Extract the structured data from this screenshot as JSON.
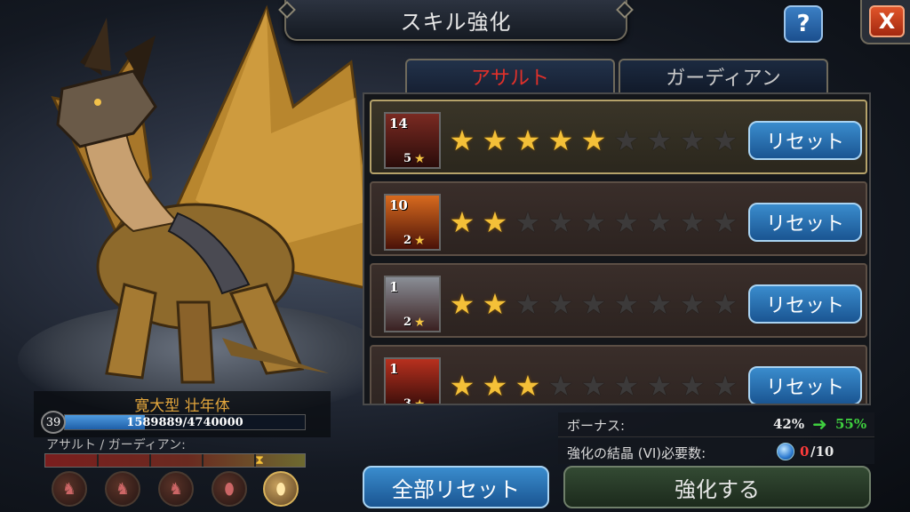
{
  "header": {
    "title": "スキル強化"
  },
  "buttons": {
    "help_label": "?",
    "close_label": "X"
  },
  "tabs": [
    {
      "label": "アサルト",
      "active": true
    },
    {
      "label": "ガーディアン",
      "active": false
    }
  ],
  "skills": [
    {
      "level": "14",
      "rank": "5",
      "stars_filled": 5,
      "stars_total": 9,
      "icon": "knights-icon",
      "reset_label": "リセット",
      "selected": true
    },
    {
      "level": "10",
      "rank": "2",
      "stars_filled": 2,
      "stars_total": 9,
      "icon": "fire-icon",
      "reset_label": "リセット",
      "selected": false
    },
    {
      "level": "1",
      "rank": "2",
      "stars_filled": 2,
      "stars_total": 9,
      "icon": "knight-icon",
      "reset_label": "リセット",
      "selected": false
    },
    {
      "level": "1",
      "rank": "3",
      "stars_filled": 3,
      "stars_total": 9,
      "icon": "warrior-icon",
      "reset_label": "リセット",
      "selected": false
    }
  ],
  "dragon": {
    "name": "寛大型 壮年体",
    "level": "39",
    "xp_text": "1589889/4740000",
    "xp_fraction": 0.335,
    "balance_label": "アサルト / ガーディアン:",
    "balance_fraction": 0.82
  },
  "dragon_slots": [
    {
      "icon": "dragon-head-icon",
      "active": false
    },
    {
      "icon": "dragon-head-icon",
      "active": false
    },
    {
      "icon": "dragon-head-icon",
      "active": false
    },
    {
      "icon": "dragon-egg-icon",
      "active": false
    },
    {
      "icon": "dragon-egg-icon",
      "active": true
    }
  ],
  "bonus": {
    "label": "ボーナス:",
    "from": "42%",
    "to": "55%"
  },
  "crystal": {
    "label": "強化の結晶 (VI)必要数:",
    "have": "0",
    "need": "/10"
  },
  "actions": {
    "reset_all_label": "全部リセット",
    "enhance_label": "強化する"
  },
  "colors": {
    "active_tab": "#e0302a",
    "button_blue": "#2a6fb0",
    "star_gold": "#f4c038",
    "bonus_green": "#3fcf3f",
    "crystal_red": "#ff3b3b"
  }
}
